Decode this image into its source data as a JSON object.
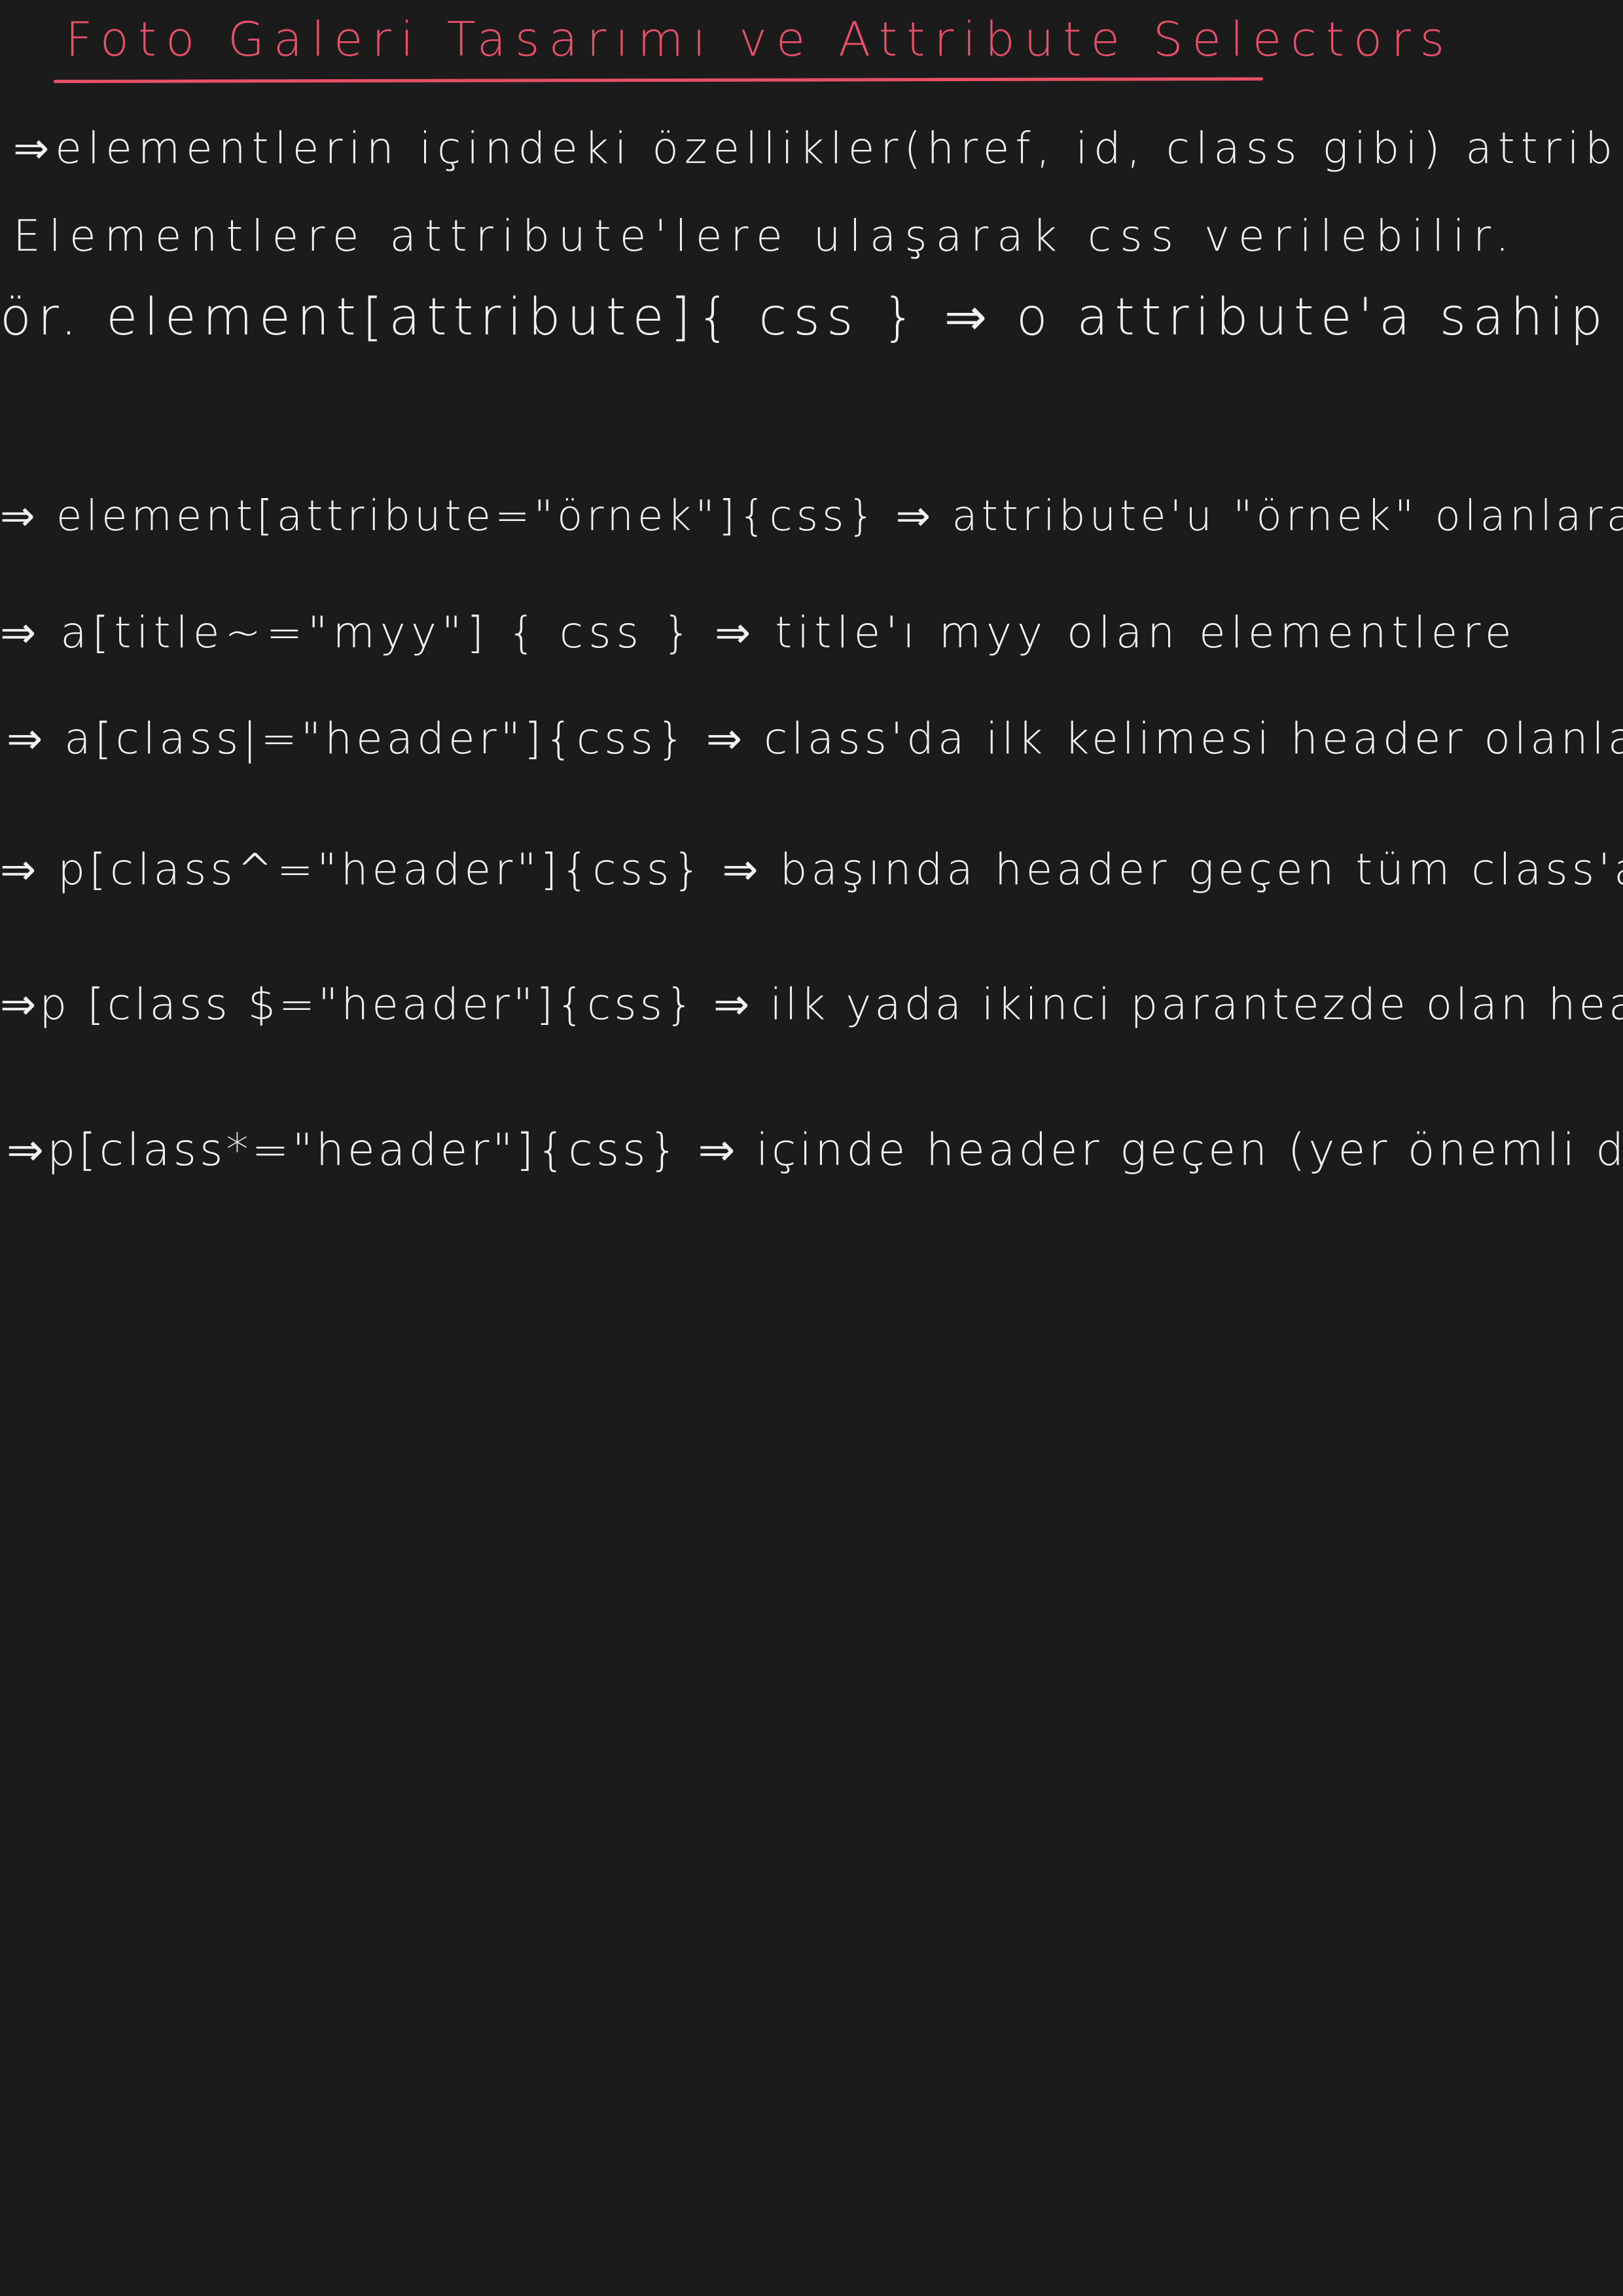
{
  "title": "Foto Galeri Tasarımı ve Attribute Selectors",
  "notes": [
    "⇒elementlerin içindeki özellikler(href, id, class gibi) attribute'dür.",
    "Elementlere attribute'lere ulaşarak css verilebilir.",
    "ör. element[attribute]{ css } ⇒ o attribute'a sahip olanlara uygular.",
    "⇒ element[attribute=\"örnek\"]{css} ⇒ attribute'u \"örnek\" olanlara uyguluyor.",
    "⇒ a[title~=\"myy\"] { css } ⇒ title'ı myy olan elementlere",
    "⇒ a[class|=\"header\"]{css} ⇒ class'da ilk kelimesi header olanlara uyguluyor.",
    "⇒ p[class^=\"header\"]{css} ⇒ başında header geçen tüm class'a sahiplere uyguluyor",
    "⇒p [class $=\"header\"]{css} ⇒ ilk yada ikinci parantezde olan header'lara uyguluyor",
    "⇒p[class*=\"header\"]{css} ⇒ içinde header geçen (yer önemli değil) uyguluyor"
  ]
}
